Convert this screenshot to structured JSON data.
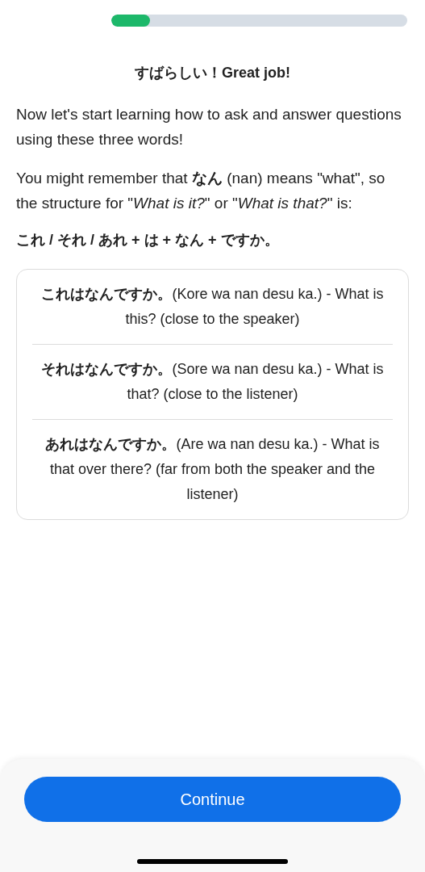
{
  "progress": {
    "level": 0.13
  },
  "title": "すばらしい！Great job!",
  "paragraphs": [
    "Now let's start learning how to ask and answer questions using these three words!",
    "You might remember that **なん** (nan) means \"what\", so the structure for \"*What is it?*\" or \"*What is that?*\" is:"
  ],
  "formula": "これ / それ / あれ + は + なん + ですか。",
  "examples": [
    "**これはなんですか。**(Kore wa nan desu ka.) - What is this? (close to the speaker)",
    "**それはなんですか。**(Sore wa nan desu ka.) - What is that? (close to the listener)",
    "**あれはなんですか。**(Are wa nan desu ka.) - What is that over there? (far from both the speaker and the listener)"
  ],
  "continue_button": "Continue"
}
